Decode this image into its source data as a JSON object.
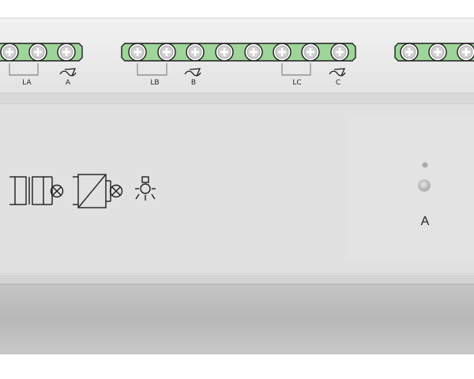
{
  "device": {
    "terminal_labels": [
      "LA",
      "A",
      "LB",
      "B",
      "LC",
      "C"
    ],
    "channel_label": "A",
    "icons": [
      "motor-with-lamp-icon",
      "dimmer-with-lamp-icon",
      "lamp-icon"
    ],
    "colors": {
      "body": "#dcdcdc",
      "panel": "#e2e2e2",
      "terminal_green": "#9fd59a",
      "terminal_outline": "#1e1e1e",
      "screw": "#c8c8c8",
      "bottom_rail": "#b9b9b9",
      "led": "#b0b0b0"
    }
  }
}
